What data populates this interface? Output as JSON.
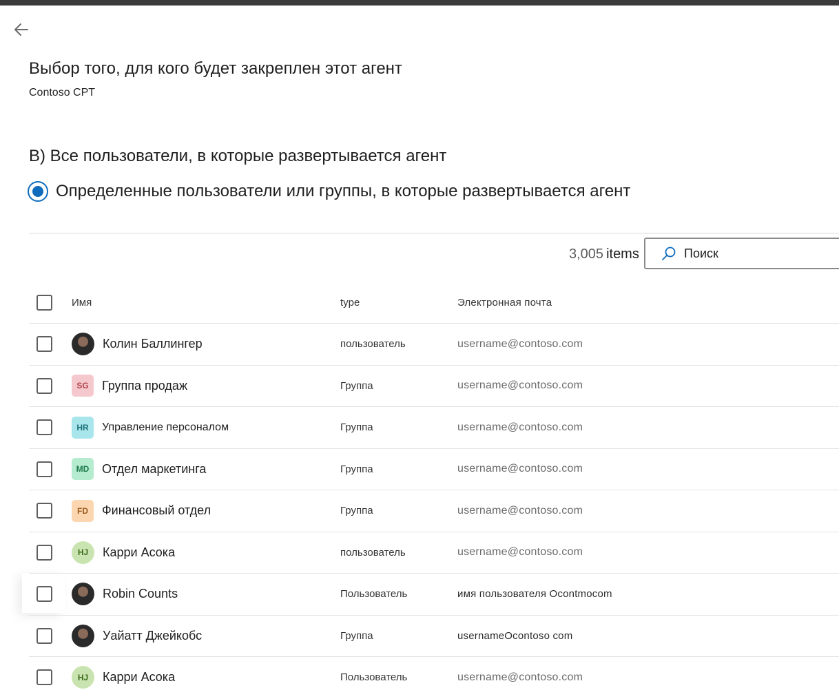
{
  "header": {
    "back_icon": "arrow-left-icon",
    "title": "Выбор того, для кого будет закреплен этот агент",
    "subtitle": "Contoso CPT"
  },
  "options": {
    "all_users_label": "B) Все пользователи, в которые развертывается агент",
    "specific_label": "Определенные пользователи или группы, в которые развертывается агент",
    "specific_selected": true
  },
  "toolbar": {
    "count_number": "3,005",
    "count_label": "items",
    "search_placeholder": "Поиск",
    "search_icon": "search-icon"
  },
  "table": {
    "columns": {
      "name": "Имя",
      "type": "type",
      "email": "Электронная почта"
    },
    "rows": [
      {
        "name": "Колин Баллингер",
        "type": "пользователь",
        "email": "username@contoso.com",
        "avatar": "photo",
        "initials": ""
      },
      {
        "name": "Группа продаж",
        "type": "Группа",
        "email": "username@contoso.com",
        "avatar": "square",
        "initials": "SG",
        "color": "#f4c8cc",
        "text_color": "#b4454f"
      },
      {
        "name": "Управление персоналом",
        "type": "Группа",
        "email": "username@contoso.com",
        "avatar": "square",
        "initials": "HR",
        "color": "#a9e6ec",
        "text_color": "#1d6f78"
      },
      {
        "name": "Отдел маркетинга",
        "type": "Группа",
        "email": "username@contoso.com",
        "avatar": "square",
        "initials": "MD",
        "color": "#b5ebcf",
        "text_color": "#1f7a4b"
      },
      {
        "name": "Финансовый отдел",
        "type": "Группа",
        "email": "username@contoso.com",
        "avatar": "square",
        "initials": "FD",
        "color": "#fbd6b1",
        "text_color": "#9c5b1d"
      },
      {
        "name": "Карри Асока",
        "type": "пользователь",
        "email": "username@contoso.com",
        "avatar": "circle",
        "initials": "HJ",
        "color": "#c9e4b0",
        "text_color": "#3d6d1e"
      },
      {
        "name": "Robin Counts",
        "type": "Пользователь",
        "email": "имя пользователя Ocontmocom",
        "avatar": "photo",
        "initials": ""
      },
      {
        "name": "Уайатт Джейкобс",
        "type": "Группа",
        "email": "usernameOcontoso com",
        "avatar": "photo",
        "initials": ""
      },
      {
        "name": "Карри Асока",
        "type": "Пользователь",
        "email": "username@contoso.com",
        "avatar": "circle",
        "initials": "HJ",
        "color": "#c9e4b0",
        "text_color": "#3d6d1e"
      }
    ]
  }
}
